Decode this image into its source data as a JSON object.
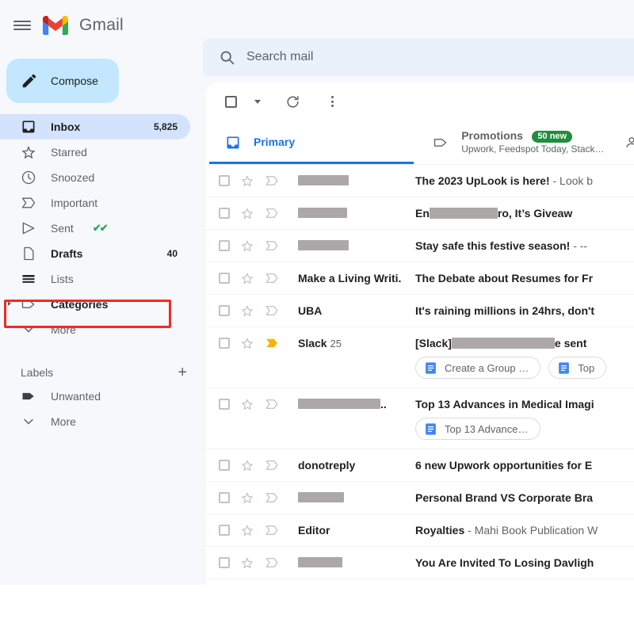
{
  "app": {
    "name": "Gmail",
    "logo_icon": "gmail-m-logo",
    "menu_icon": "hamburger-menu-icon"
  },
  "search": {
    "placeholder": "Search mail",
    "icon": "search-icon",
    "value": ""
  },
  "compose": {
    "label": "Compose",
    "icon": "pencil-icon"
  },
  "sidebar": {
    "items": [
      {
        "label": "Inbox",
        "count": "5,825",
        "icon": "inbox-icon",
        "active": true
      },
      {
        "label": "Starred",
        "count": "",
        "icon": "star-icon",
        "active": false
      },
      {
        "label": "Snoozed",
        "count": "",
        "icon": "clock-icon",
        "active": false
      },
      {
        "label": "Important",
        "count": "",
        "icon": "important-marker-icon",
        "active": false
      },
      {
        "label": "Sent",
        "count": "",
        "icon": "send-icon",
        "active": false,
        "suffix": "✔✔"
      },
      {
        "label": "Drafts",
        "count": "40",
        "icon": "draft-page-icon",
        "active": false
      },
      {
        "label": "Lists",
        "count": "",
        "icon": "lists-bars-icon",
        "active": false
      },
      {
        "label": "Categories",
        "count": "",
        "icon": "tag-icon",
        "active": false
      },
      {
        "label": "More",
        "count": "",
        "icon": "chevron-down-icon",
        "active": false
      }
    ],
    "labels_section": {
      "title": "Labels",
      "add_icon": "plus-icon"
    },
    "labels": [
      {
        "label": "Unwanted",
        "icon": "label-tag-icon"
      },
      {
        "label": "More",
        "icon": "chevron-down-icon"
      }
    ]
  },
  "highlight": {
    "target": "Lists",
    "color": "#f22a22"
  },
  "toolbar": {
    "select_all_icon": "checkbox-icon",
    "select_caret_icon": "chevron-down-icon",
    "refresh_icon": "refresh-icon",
    "more_icon": "more-vertical-icon"
  },
  "tabs": [
    {
      "label": "Primary",
      "icon": "inbox-tab-icon",
      "subtitle": "",
      "badge": "",
      "active": true
    },
    {
      "label": "Promotions",
      "icon": "tag-tab-icon",
      "subtitle": "Upwork, Feedspot Today, Stack…",
      "badge": "50 new",
      "active": false
    },
    {
      "label": "",
      "icon": "social-person-icon",
      "subtitle": "",
      "badge": "",
      "active": false
    }
  ],
  "emails": [
    {
      "sender": "",
      "sender_redacted": true,
      "redact_width": 64,
      "subject": "The 2023 UpLook is here!",
      "snippet": " - Look b",
      "subject_redacted": false,
      "important": false,
      "chips": []
    },
    {
      "sender": "",
      "sender_redacted": true,
      "redact_width": 62,
      "subject_pre": "En",
      "subject_redact_width": 86,
      "subject_post": "ro, It’s Giveaw",
      "subject": "",
      "snippet": "",
      "subject_redacted": true,
      "important": false,
      "chips": []
    },
    {
      "sender": "",
      "sender_redacted": true,
      "redact_width": 64,
      "subject": "Stay safe this festive season!",
      "snippet": " - --",
      "subject_redacted": false,
      "important": false,
      "chips": []
    },
    {
      "sender": "Make a Living Writi.",
      "sender_redacted": false,
      "subject": "The Debate about Resumes for Fr",
      "snippet": "",
      "subject_redacted": false,
      "important": false,
      "chips": []
    },
    {
      "sender": "UBA",
      "sender_redacted": false,
      "subject": "It's raining millions in 24hrs, don't",
      "snippet": "",
      "subject_redacted": false,
      "important": false,
      "chips": []
    },
    {
      "sender": "Slack",
      "sender_count": "25",
      "sender_redacted": false,
      "subject_pre": "[Slack]",
      "subject_redact_width": 130,
      "subject_post": "e sent",
      "subject": "",
      "snippet": "",
      "subject_redacted": true,
      "important": true,
      "chips": [
        {
          "label": "Create a Group …",
          "icon": "google-docs-icon"
        },
        {
          "label": "Top",
          "icon": "google-docs-icon"
        }
      ]
    },
    {
      "sender": "",
      "sender_redacted": true,
      "redact_width": 104,
      "sender_suffix": "..",
      "subject": "Top 13 Advances in Medical Imagi",
      "snippet": "",
      "subject_redacted": false,
      "important": false,
      "chips": [
        {
          "label": "Top 13 Advance…",
          "icon": "google-docs-icon"
        }
      ]
    },
    {
      "sender": "donotreply",
      "sender_redacted": false,
      "subject": "6 new Upwork opportunities for E",
      "snippet": "",
      "subject_redacted": false,
      "important": false,
      "chips": []
    },
    {
      "sender": "",
      "sender_redacted": true,
      "redact_width": 58,
      "subject": "Personal Brand VS Corporate Bra",
      "snippet": "",
      "subject_redacted": false,
      "important": false,
      "chips": []
    },
    {
      "sender": "Editor",
      "sender_redacted": false,
      "subject": "Royalties",
      "snippet": " - Mahi Book Publication W",
      "subject_redacted": false,
      "important": false,
      "chips": []
    },
    {
      "sender": "",
      "sender_redacted": true,
      "redact_width": 56,
      "subject": "You Are Invited To Losing Davligh",
      "snippet": "",
      "subject_redacted": false,
      "important": false,
      "chips": []
    }
  ]
}
